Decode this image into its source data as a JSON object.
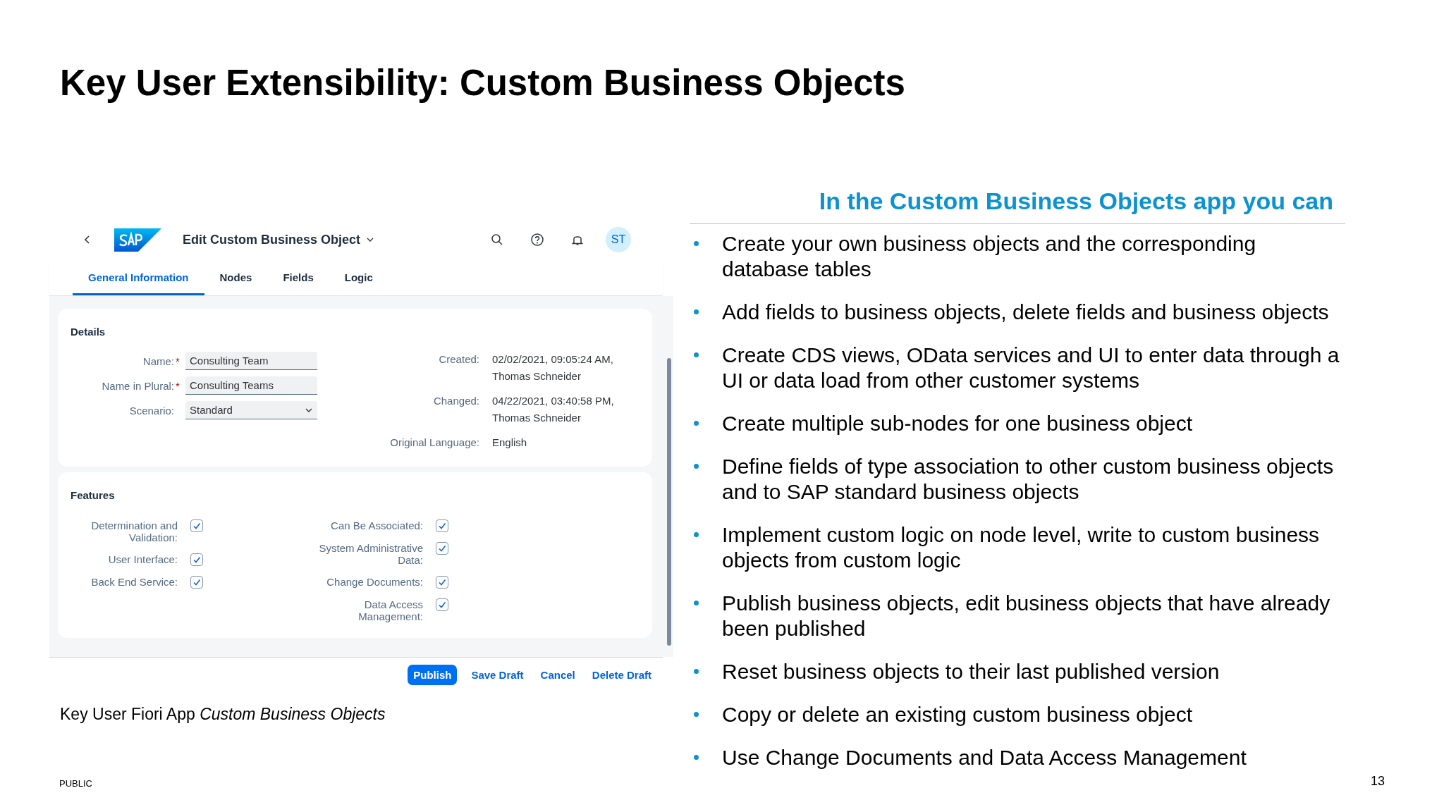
{
  "slide": {
    "title": "Key User Extensibility: Custom Business Objects"
  },
  "app": {
    "title": "Edit Custom Business Object",
    "avatar": "ST",
    "tabs": [
      {
        "label": "General Information",
        "selected": true
      },
      {
        "label": "Nodes",
        "selected": false
      },
      {
        "label": "Fields",
        "selected": false
      },
      {
        "label": "Logic",
        "selected": false
      }
    ],
    "details": {
      "heading": "Details",
      "required_mark": "*",
      "fields": [
        {
          "label": "Name:",
          "required": true,
          "value": "Consulting Team",
          "kind": "input"
        },
        {
          "label": "Name in Plural:",
          "required": true,
          "value": "Consulting Teams",
          "kind": "input"
        },
        {
          "label": "Scenario:",
          "required": false,
          "value": "Standard",
          "kind": "select"
        }
      ],
      "info": [
        {
          "label": "Created:",
          "value": "02/02/2021, 09:05:24 AM, Thomas Schneider"
        },
        {
          "label": "Changed:",
          "value": "04/22/2021, 03:40:58 PM, Thomas Schneider"
        },
        {
          "label": "Original Language:",
          "value": "English"
        }
      ]
    },
    "features": {
      "heading": "Features",
      "left": [
        {
          "label": "Determination and Validation:",
          "checked": true
        },
        {
          "label": "User Interface:",
          "checked": true
        },
        {
          "label": "Back End Service:",
          "checked": true
        }
      ],
      "right": [
        {
          "label": "Can Be Associated:",
          "checked": true
        },
        {
          "label": "System Administrative Data:",
          "checked": true
        },
        {
          "label": "Change Documents:",
          "checked": true
        },
        {
          "label": "Data Access Management:",
          "checked": true
        }
      ]
    },
    "actions": [
      {
        "label": "Publish",
        "kind": "primary"
      },
      {
        "label": "Save Draft",
        "kind": "link"
      },
      {
        "label": "Cancel",
        "kind": "link"
      },
      {
        "label": "Delete Draft",
        "kind": "link"
      }
    ]
  },
  "caption": "Key User Fiori App *Custom Business Objects*",
  "panel": {
    "heading": "In the Custom Business Objects app you can",
    "bullets": [
      "Create your own business objects and the corresponding database tables",
      "Add fields to business objects, delete fields and business objects",
      "Create CDS views, OData services and UI to enter data through a UI or data load from other customer systems",
      "Create multiple sub-nodes for one business object",
      "Define fields of type association to other custom business objects and to SAP standard business objects",
      "Implement custom logic on node level, write to custom business objects from custom logic",
      "Publish business objects, edit business objects that have already been published",
      "Reset business objects to their last published version",
      "Copy or delete an existing custom business object",
      "Use Change Documents and Data Access Management"
    ]
  },
  "footer": {
    "classification": "PUBLIC",
    "page": "13"
  }
}
